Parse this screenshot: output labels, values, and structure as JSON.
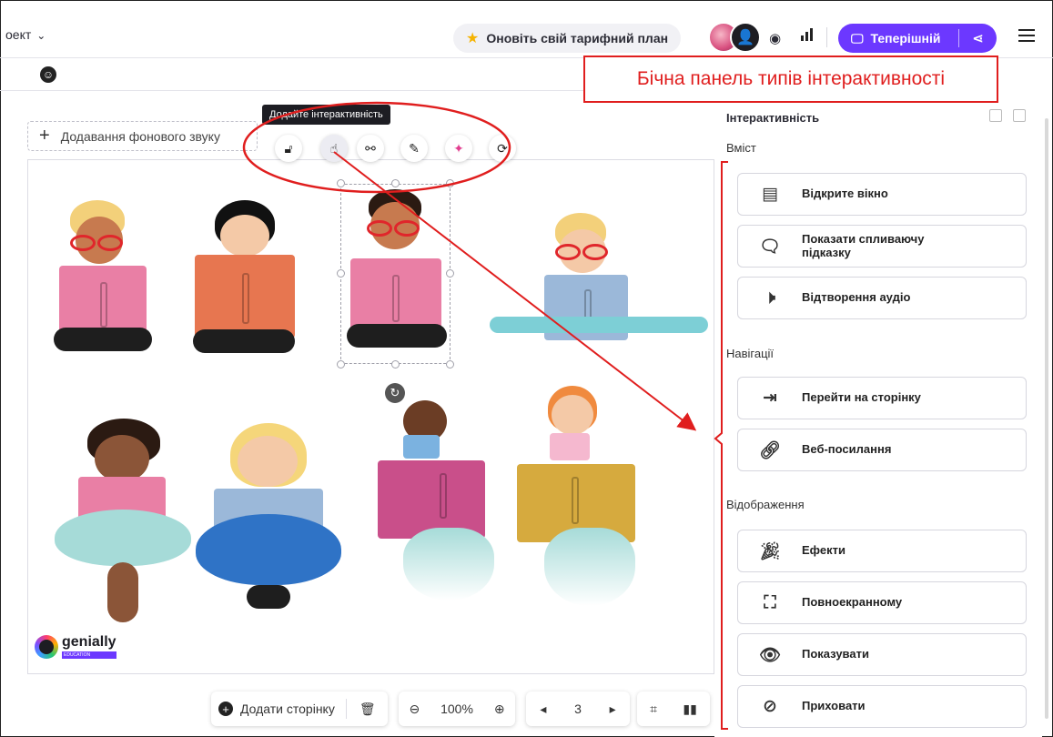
{
  "topbar": {
    "project_label": "оект",
    "upgrade_label": "Оновіть свій тарифний план",
    "present_label": "Теперішній"
  },
  "annotation": {
    "callout_text": "Бічна панель типів інтерактивності",
    "color": "#e01e1e"
  },
  "editor": {
    "background_sound_label": "Додавання фонового звуку",
    "tooltip": "Додайте інтерактивність",
    "tools": [
      "lock-icon",
      "interactivity-icon",
      "animation-icon",
      "edit-icon",
      "magic-icon",
      "replace-icon"
    ]
  },
  "brand": {
    "logo_text": "genially",
    "edu_text": "EDUCATION",
    "accent": "#6c38ff"
  },
  "bottombar": {
    "add_page_label": "Додати сторінку",
    "zoom_label": "100%",
    "page_number": "3"
  },
  "sidebar": {
    "title": "Інтерактивність",
    "sections": {
      "content": "Вміст",
      "navigation": "Навігації",
      "display": "Відображення"
    },
    "content_items": [
      {
        "label": "Відкрите вікно",
        "icon": "window-icon"
      },
      {
        "label": "Показати спливаючу підказку",
        "icon": "tooltip-icon"
      },
      {
        "label": "Відтворення аудіо",
        "icon": "audio-icon"
      }
    ],
    "navigation_items": [
      {
        "label": "Перейти на сторінку",
        "icon": "goto-page-icon"
      },
      {
        "label": "Веб-посилання",
        "icon": "web-link-icon"
      }
    ],
    "display_items": [
      {
        "label": "Ефекти",
        "icon": "effects-icon"
      },
      {
        "label": "Повноекранному",
        "icon": "fullscreen-icon"
      },
      {
        "label": "Показувати",
        "icon": "show-icon"
      },
      {
        "label": "Приховати",
        "icon": "hide-icon"
      }
    ]
  }
}
